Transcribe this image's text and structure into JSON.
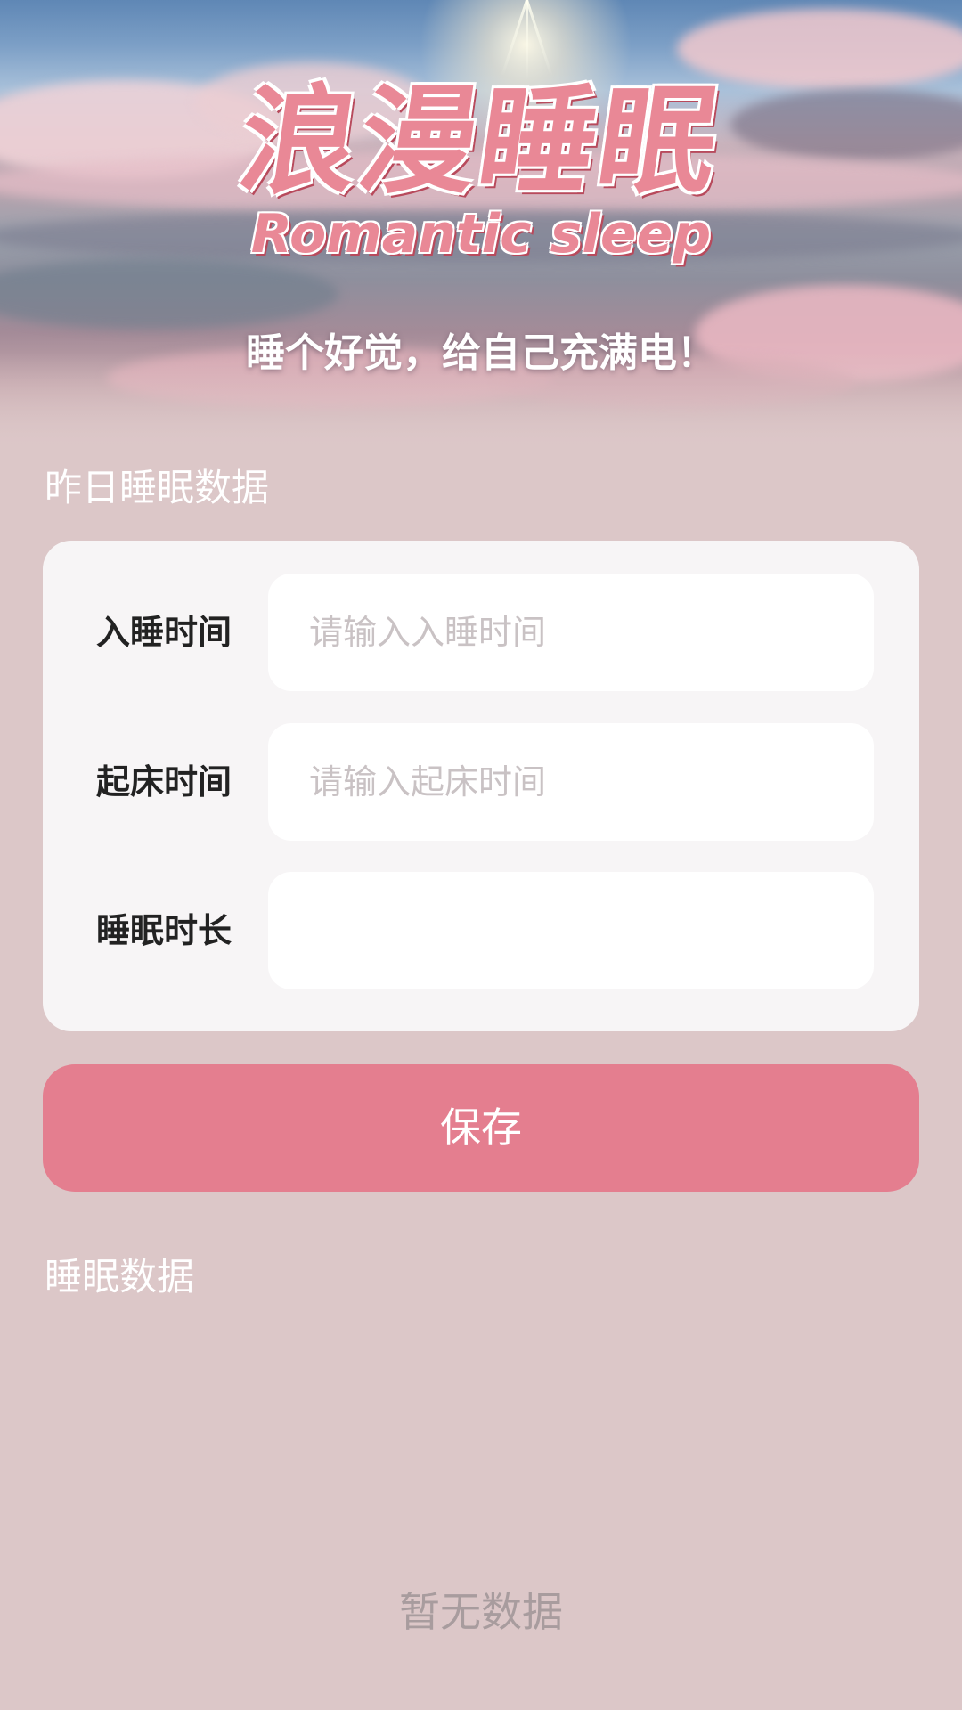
{
  "header": {
    "title": "浪漫睡眠",
    "subtitle": "Romantic sleep",
    "slogan": "睡个好觉，给自己充满电！"
  },
  "yesterday": {
    "section_title": "昨日睡眠数据",
    "fields": [
      {
        "label": "入睡时间",
        "value": "",
        "placeholder": "请输入入睡时间"
      },
      {
        "label": "起床时间",
        "value": "",
        "placeholder": "请输入起床时间"
      },
      {
        "label": "睡眠时长",
        "value": "",
        "placeholder": ""
      }
    ],
    "save_label": "保存"
  },
  "history": {
    "section_title": "睡眠数据",
    "empty_text": "暂无数据"
  },
  "colors": {
    "background": "#dcc7c8",
    "card": "#f7f5f6",
    "accent": "#e47e8f",
    "title_pink": "#e98896"
  }
}
